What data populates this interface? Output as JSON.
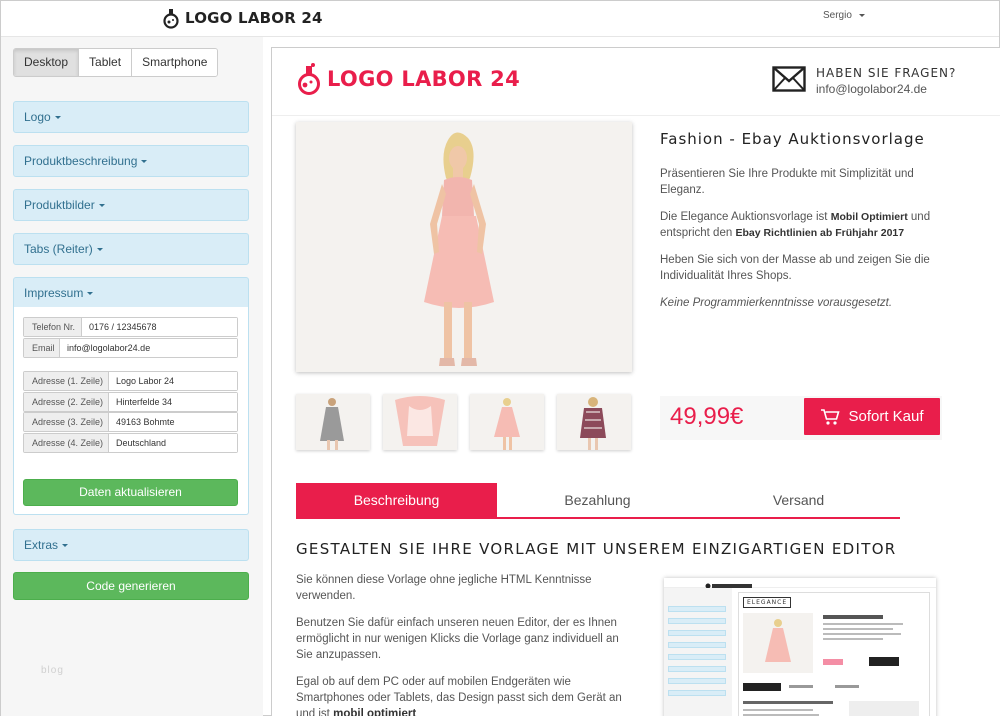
{
  "app": {
    "logo_text": "LOGO LABOR 24",
    "user": "Sergio",
    "watermark": "blog"
  },
  "devices": [
    {
      "label": "Desktop",
      "active": true
    },
    {
      "label": "Tablet",
      "active": false
    },
    {
      "label": "Smartphone",
      "active": false
    }
  ],
  "accordion": {
    "logo": "Logo",
    "produktbeschreibung": "Produktbeschreibung",
    "produktbilder": "Produktbilder",
    "tabs": "Tabs (Reiter)",
    "impressum": "Impressum",
    "extras": "Extras"
  },
  "impressum": {
    "telefon": {
      "label": "Telefon Nr.",
      "value": "0176 / 12345678"
    },
    "email": {
      "label": "Email",
      "value": "info@logolabor24.de"
    },
    "adresse1": {
      "label": "Adresse (1. Zeile)",
      "value": "Logo Labor 24"
    },
    "adresse2": {
      "label": "Adresse (2. Zeile)",
      "value": "Hinterfelde 34"
    },
    "adresse3": {
      "label": "Adresse (3. Zeile)",
      "value": "49163 Bohmte"
    },
    "adresse4": {
      "label": "Adresse (4. Zeile)",
      "value": "Deutschland"
    },
    "update_button": "Daten aktualisieren"
  },
  "generate_button": "Code generieren",
  "preview": {
    "logo_text": "LOGO LABOR 24",
    "contact_question": "HABEN SIE FRAGEN?",
    "contact_email": "info@logolabor24.de",
    "product_title": "Fashion - Ebay Auktionsvorlage",
    "p1": "Präsentieren Sie Ihre Produkte mit Simplizität und Eleganz.",
    "p2_a": "Die Elegance Auktionsvorlage ist",
    "p2_b": "Mobil Optimiert",
    "p2_c": "und entspricht den",
    "p2_d": "Ebay Richtlinien ab Frühjahr 2017",
    "p3": "Heben Sie sich von der Masse ab und zeigen Sie die Individualität Ihres Shops.",
    "p4": "Keine Programmierkenntnisse vorausgesetzt.",
    "price": "49,99€",
    "buy_label": "Sofort Kauf",
    "tabs": [
      "Beschreibung",
      "Bezahlung",
      "Versand"
    ],
    "section_title": "GESTALTEN SIE IHRE VORLAGE MIT UNSEREM EINZIGARTIGEN EDITOR",
    "d1": "Sie können diese Vorlage ohne jegliche HTML Kenntnisse verwenden.",
    "d2": "Benutzen Sie dafür einfach unseren neuen Editor, der es Ihnen ermöglicht in nur wenigen Klicks die Vorlage ganz individuell an Sie anzupassen.",
    "d3_a": "Egal ob auf dem PC oder auf mobilen Endgeräten wie Smartphones oder Tablets, das Design passt sich dem Gerät an und ist",
    "d3_b": "mobil optimiert",
    "mini_title": "ELEGANCE"
  },
  "colors": {
    "brand": "#e91e4b",
    "accordion": "#d9edf7",
    "success": "#5cb85c"
  }
}
